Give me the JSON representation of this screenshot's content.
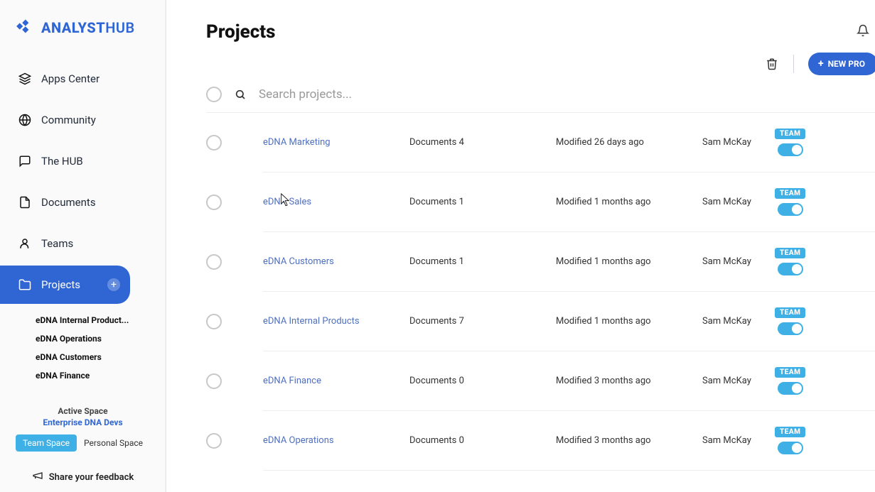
{
  "brand": {
    "pre": "ANALYST",
    "post": "HUB"
  },
  "sidebar": {
    "items": [
      {
        "label": "Apps Center"
      },
      {
        "label": "Community"
      },
      {
        "label": "The HUB"
      },
      {
        "label": "Documents"
      },
      {
        "label": "Teams"
      },
      {
        "label": "Projects"
      }
    ],
    "sub": [
      {
        "label": "eDNA Internal Product..."
      },
      {
        "label": "eDNA Operations"
      },
      {
        "label": "eDNA Customers"
      },
      {
        "label": "eDNA Finance"
      }
    ],
    "space_title": "Active Space",
    "space_name": "Enterprise DNA Devs",
    "tab_team": "Team Space",
    "tab_personal": "Personal Space",
    "feedback": "Share your feedback"
  },
  "page": {
    "title": "Projects",
    "new_button": "NEW PRO",
    "search_placeholder": "Search projects...",
    "team_label": "TEAM"
  },
  "projects": [
    {
      "name": "eDNA Marketing",
      "docs": "Documents 4",
      "modified": "Modified 26 days ago",
      "owner": "Sam McKay"
    },
    {
      "name": "eDNA Sales",
      "docs": "Documents 1",
      "modified": "Modified 1 months ago",
      "owner": "Sam McKay"
    },
    {
      "name": "eDNA Customers",
      "docs": "Documents 1",
      "modified": "Modified 1 months ago",
      "owner": "Sam McKay"
    },
    {
      "name": "eDNA Internal Products",
      "docs": "Documents 7",
      "modified": "Modified 1 months ago",
      "owner": "Sam McKay"
    },
    {
      "name": "eDNA Finance",
      "docs": "Documents 0",
      "modified": "Modified 3 months ago",
      "owner": "Sam McKay"
    },
    {
      "name": "eDNA Operations",
      "docs": "Documents 0",
      "modified": "Modified 3 months ago",
      "owner": "Sam McKay"
    }
  ]
}
